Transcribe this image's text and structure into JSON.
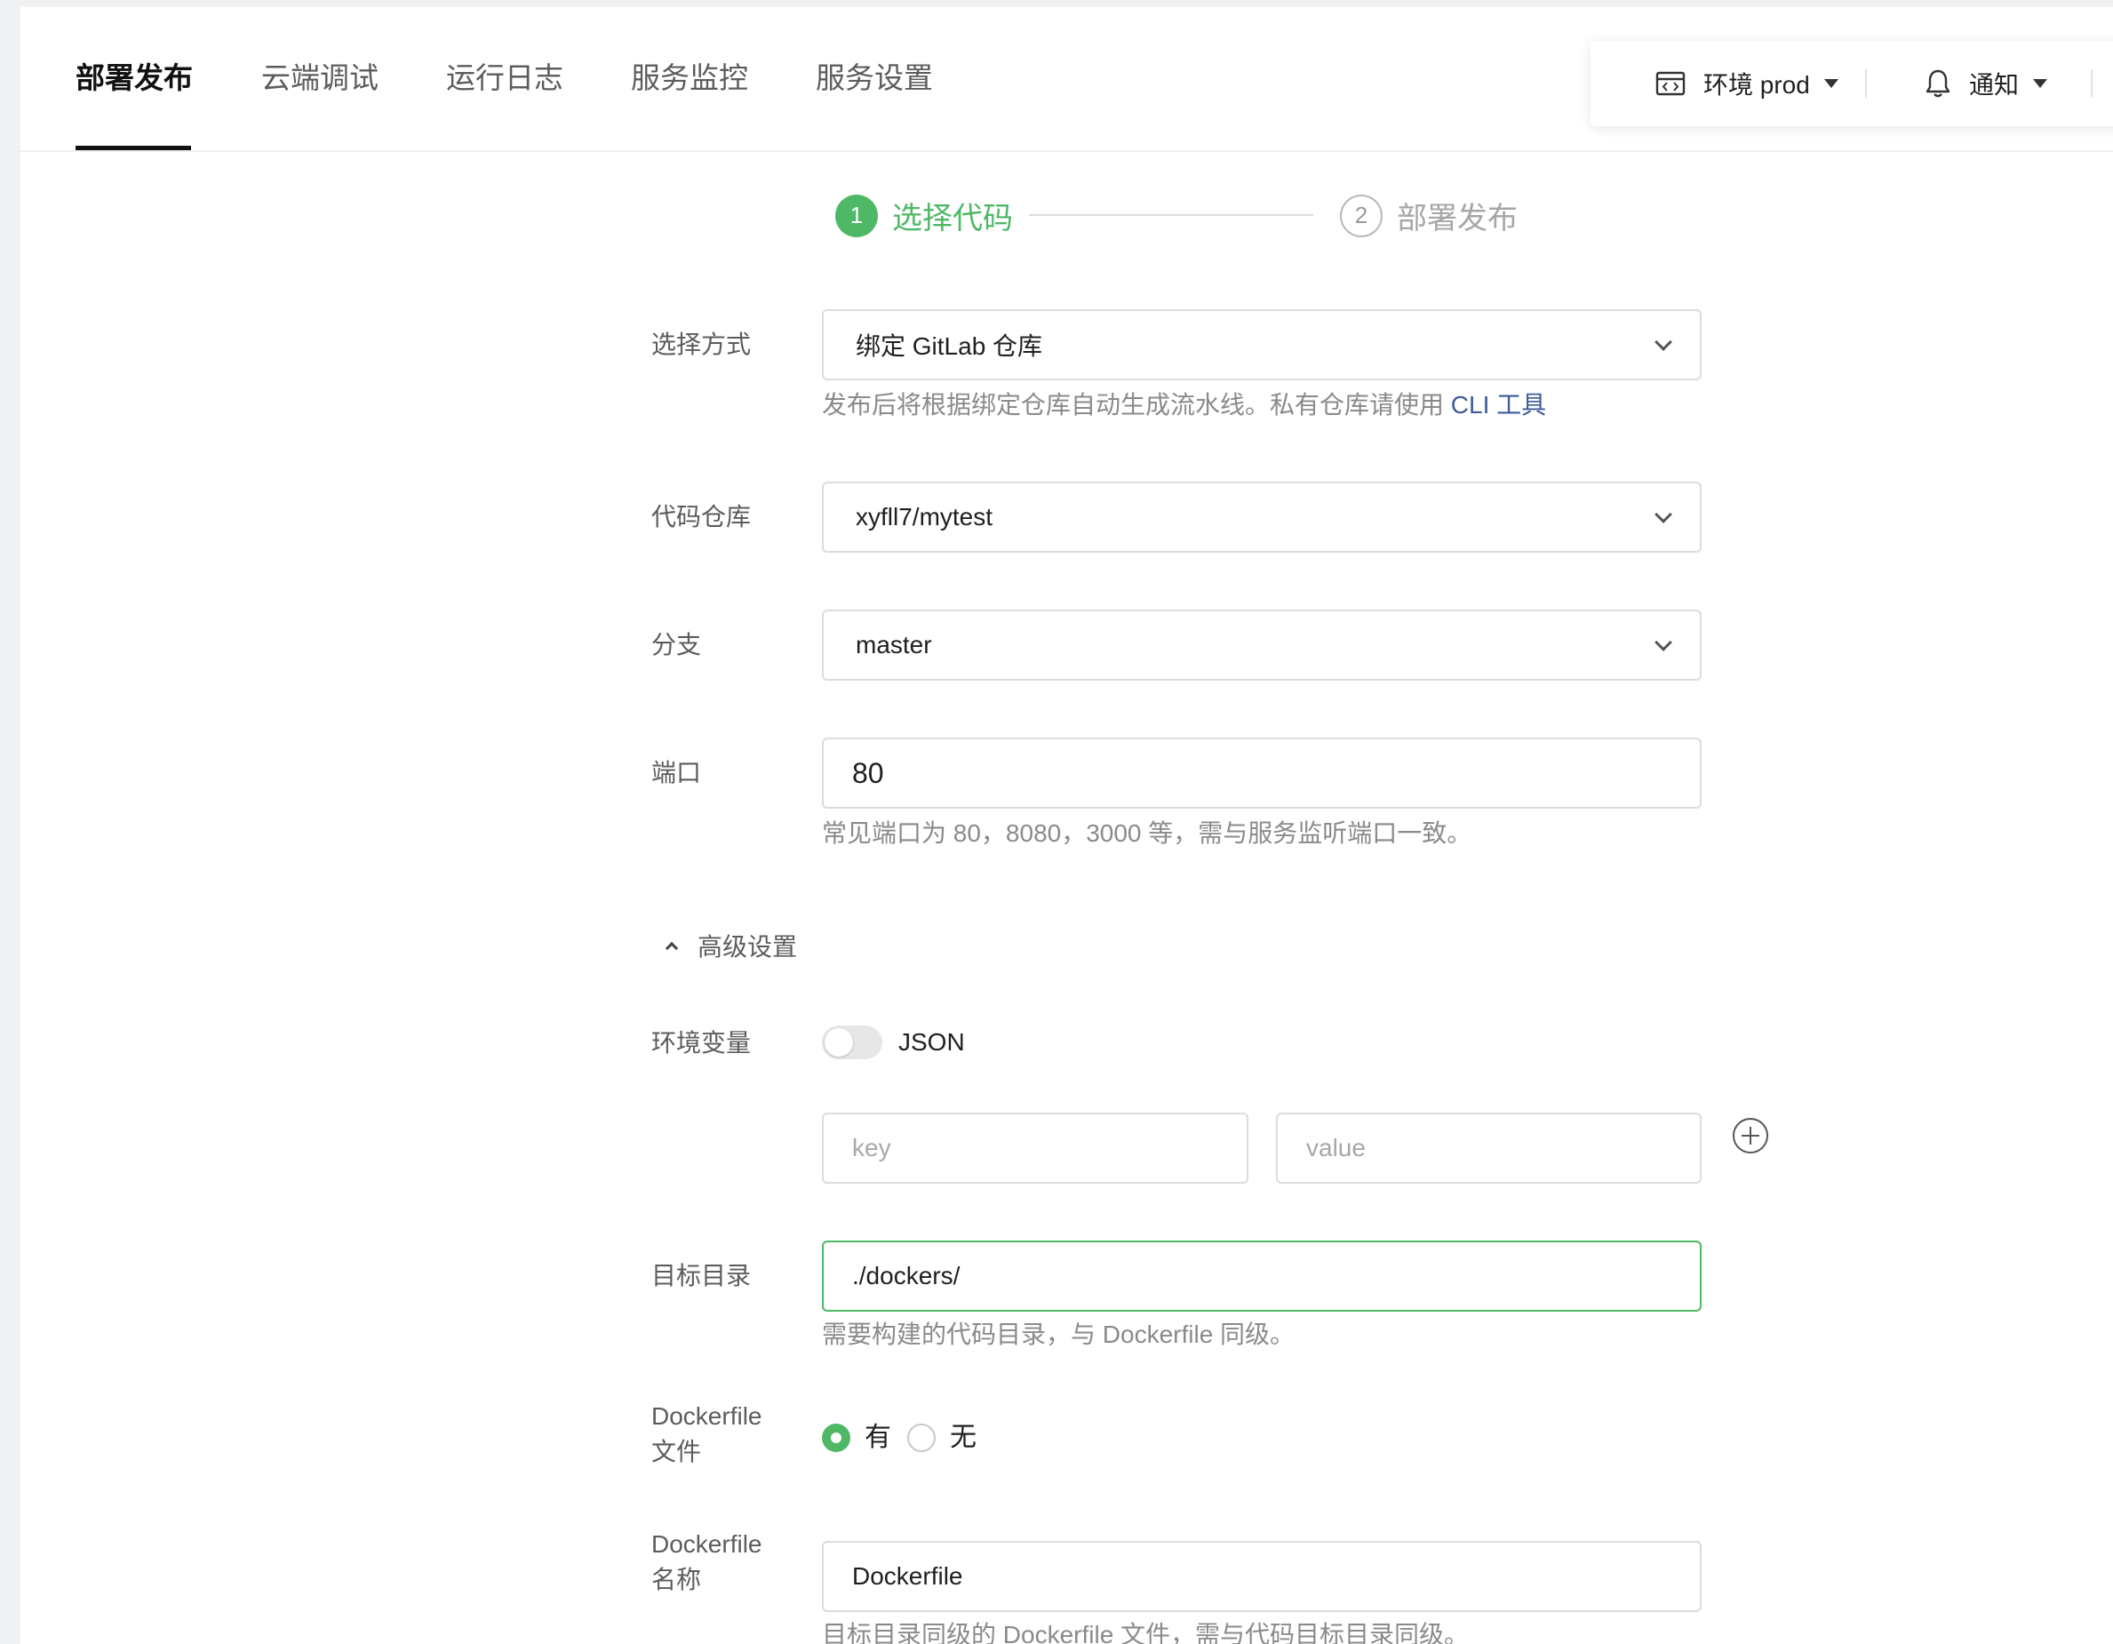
{
  "tabs": [
    {
      "label": "部署发布",
      "active": true
    },
    {
      "label": "云端调试"
    },
    {
      "label": "运行日志"
    },
    {
      "label": "服务监控"
    },
    {
      "label": "服务设置"
    }
  ],
  "toolbar": {
    "env_label": "环境 prod",
    "notify_label": "通知"
  },
  "steps": [
    {
      "num": "1",
      "label": "选择代码",
      "state": "active"
    },
    {
      "num": "2",
      "label": "部署发布",
      "state": "inactive"
    }
  ],
  "form": {
    "method": {
      "label": "选择方式",
      "value": "绑定 GitLab 仓库",
      "hint": "发布后将根据绑定仓库自动生成流水线。私有仓库请使用 ",
      "hint_link": "CLI 工具"
    },
    "repo": {
      "label": "代码仓库",
      "value": "xyfll7/mytest"
    },
    "branch": {
      "label": "分支",
      "value": "master"
    },
    "port": {
      "label": "端口",
      "value": "80",
      "hint": "常见端口为 80，8080，3000 等，需与服务监听端口一致。"
    },
    "advanced_label": "高级设置",
    "env": {
      "label": "环境变量",
      "toggle_label": "JSON",
      "key_placeholder": "key",
      "value_placeholder": "value"
    },
    "target_dir": {
      "label": "目标目录",
      "value": "./dockers/",
      "hint": "需要构建的代码目录，与 Dockerfile 同级。"
    },
    "dockerfile": {
      "label_line1": "Dockerfile",
      "label_line2": "文件",
      "option_yes": "有",
      "option_no": "无",
      "selected": "有"
    },
    "dockerfile_name": {
      "label_line1": "Dockerfile",
      "label_line2": "名称",
      "value": "Dockerfile",
      "hint": "目标目录同级的 Dockerfile 文件，需与代码目标目录同级。"
    }
  }
}
